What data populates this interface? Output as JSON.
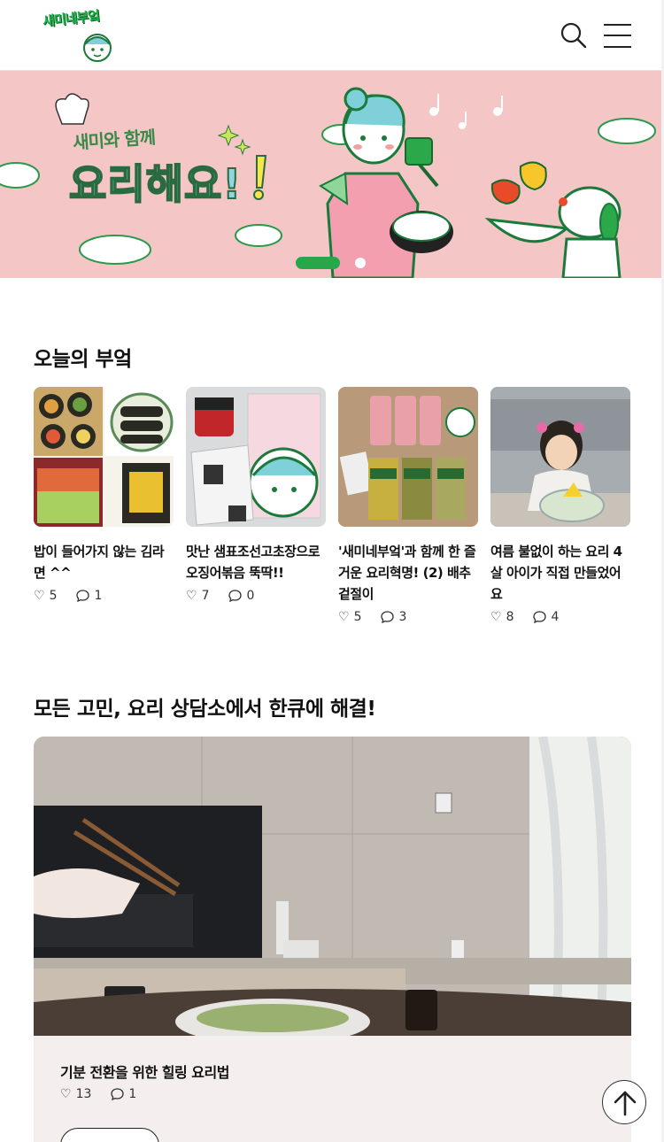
{
  "header": {
    "logo_text": "새미네부엌",
    "search_icon": "search-icon",
    "menu_icon": "hamburger-menu-icon"
  },
  "banner": {
    "subtitle": "새미와 함께",
    "title": "요리해요!",
    "slide_indicator": {
      "active": 1,
      "total": 2
    }
  },
  "today_kitchen": {
    "title": "오늘의 부엌",
    "cards": [
      {
        "title": "밥이 들어가지 않는 김라면 ^^",
        "likes": "5",
        "comments": "1"
      },
      {
        "title": "맛난 샘표조선고초장으로 오징어볶음 뚝딱!!",
        "likes": "7",
        "comments": "0"
      },
      {
        "title": "'새미네부엌'과 함께 한 즐거운 요리혁명! (2) 배추겉절이",
        "likes": "5",
        "comments": "3"
      },
      {
        "title": "여름 불없이 하는 요리 4살 아이가 직접 만들었어요",
        "likes": "8",
        "comments": "4"
      }
    ]
  },
  "consult": {
    "title": "모든 고민, 요리 상담소에서 한큐에 해결!",
    "feature": {
      "title": "기분 전환을 위한 힐링 요리법",
      "likes": "13",
      "comments": "1"
    }
  },
  "icons": {
    "like": "heart-icon",
    "comment": "comment-icon",
    "top": "arrow-up-icon"
  },
  "colors": {
    "brand_green": "#29a64a",
    "banner_pink": "#f4c6c6"
  }
}
